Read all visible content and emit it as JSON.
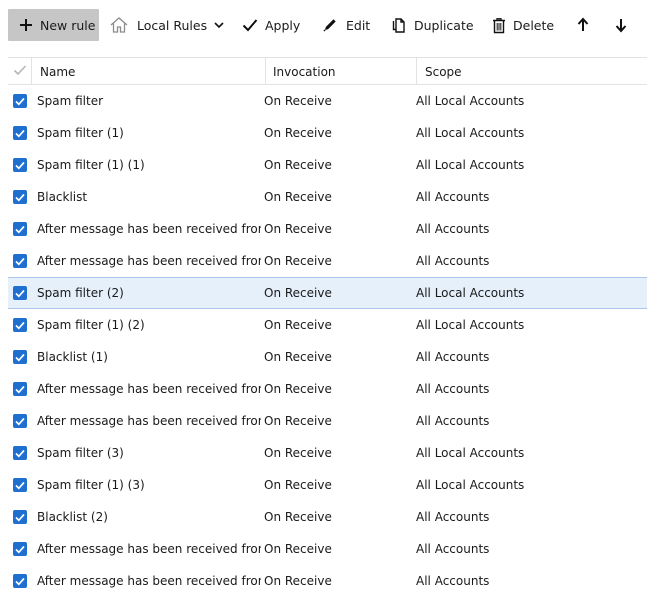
{
  "toolbar": {
    "new_rule": "New rule",
    "local_rules": "Local Rules",
    "apply": "Apply",
    "edit": "Edit",
    "duplicate": "Duplicate",
    "delete": "Delete"
  },
  "columns": {
    "name": "Name",
    "invocation": "Invocation",
    "scope": "Scope"
  },
  "rows": [
    {
      "name": "Spam filter",
      "invocation": "On Receive",
      "scope": "All Local Accounts",
      "checked": true,
      "selected": false
    },
    {
      "name": "Spam filter (1)",
      "invocation": "On Receive",
      "scope": "All Local Accounts",
      "checked": true,
      "selected": false
    },
    {
      "name": "Spam filter (1) (1)",
      "invocation": "On Receive",
      "scope": "All Local Accounts",
      "checked": true,
      "selected": false
    },
    {
      "name": "Blacklist",
      "invocation": "On Receive",
      "scope": "All Accounts",
      "checked": true,
      "selected": false
    },
    {
      "name": "After message has been received from '...",
      "invocation": "On Receive",
      "scope": "All Accounts",
      "checked": true,
      "selected": false
    },
    {
      "name": "After message has been received from '...",
      "invocation": "On Receive",
      "scope": "All Accounts",
      "checked": true,
      "selected": false
    },
    {
      "name": "Spam filter (2)",
      "invocation": "On Receive",
      "scope": "All Local Accounts",
      "checked": true,
      "selected": true
    },
    {
      "name": "Spam filter (1) (2)",
      "invocation": "On Receive",
      "scope": "All Local Accounts",
      "checked": true,
      "selected": false
    },
    {
      "name": "Blacklist (1)",
      "invocation": "On Receive",
      "scope": "All Accounts",
      "checked": true,
      "selected": false
    },
    {
      "name": "After message has been received from '...",
      "invocation": "On Receive",
      "scope": "All Accounts",
      "checked": true,
      "selected": false
    },
    {
      "name": "After message has been received from '...",
      "invocation": "On Receive",
      "scope": "All Accounts",
      "checked": true,
      "selected": false
    },
    {
      "name": "Spam filter (3)",
      "invocation": "On Receive",
      "scope": "All Local Accounts",
      "checked": true,
      "selected": false
    },
    {
      "name": "Spam filter (1) (3)",
      "invocation": "On Receive",
      "scope": "All Local Accounts",
      "checked": true,
      "selected": false
    },
    {
      "name": "Blacklist (2)",
      "invocation": "On Receive",
      "scope": "All Accounts",
      "checked": true,
      "selected": false
    },
    {
      "name": "After message has been received from '...",
      "invocation": "On Receive",
      "scope": "All Accounts",
      "checked": true,
      "selected": false
    },
    {
      "name": "After message has been received from '...",
      "invocation": "On Receive",
      "scope": "All Accounts",
      "checked": true,
      "selected": false
    }
  ],
  "colors": {
    "accent": "#1f6fd1",
    "selected_row": "#e5f0fb",
    "selected_border": "#a9c7ea",
    "primary_button": "#c6c6c6"
  }
}
